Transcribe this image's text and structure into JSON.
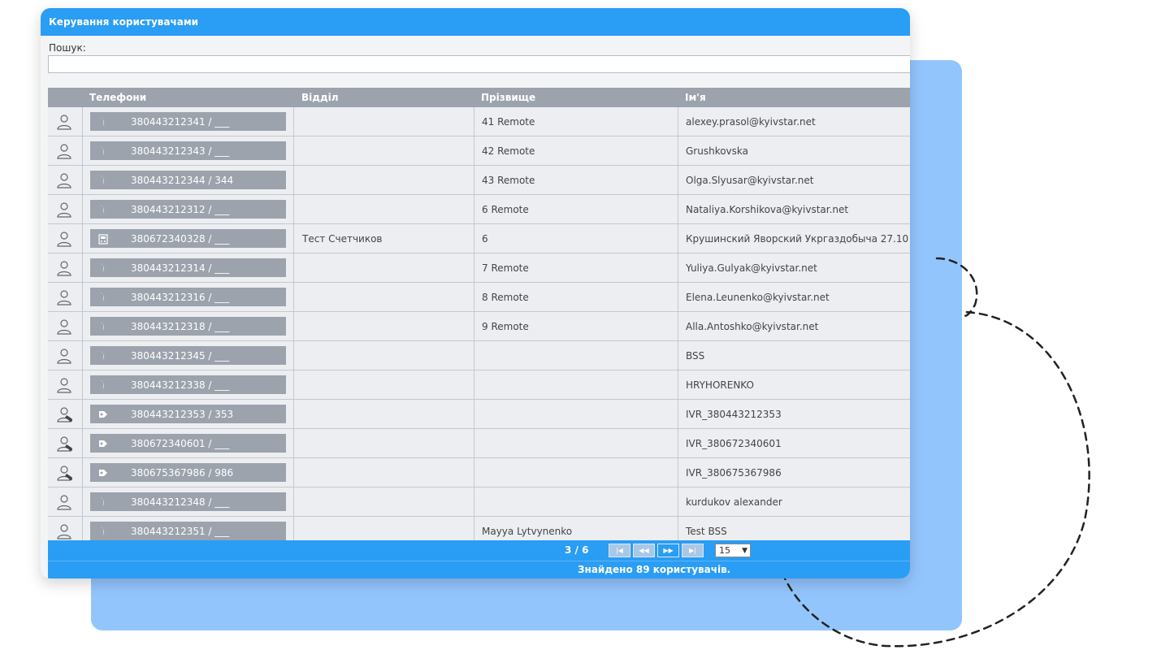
{
  "panel": {
    "title": "Керування користувачами"
  },
  "search": {
    "label": "Пошук:",
    "value": "",
    "placeholder": ""
  },
  "table": {
    "headers": {
      "phones": "Телефони",
      "department": "Відділ",
      "surname": "Прізвище",
      "name": "Ім'я"
    },
    "rows": [
      {
        "user_icon": "user-icon",
        "phone_icon": "handset-icon",
        "phone": "380443212341 / ___",
        "department": "",
        "surname": "41 Remote",
        "name": "alexey.prasol@kyivstar.net"
      },
      {
        "user_icon": "user-icon",
        "phone_icon": "handset-icon",
        "phone": "380443212343 / ___",
        "department": "",
        "surname": "42 Remote",
        "name": "Grushkovska"
      },
      {
        "user_icon": "user-icon",
        "phone_icon": "handset-icon",
        "phone": "380443212344 / 344",
        "department": "",
        "surname": "43 Remote",
        "name": "Olga.Slyusar@kyivstar.net"
      },
      {
        "user_icon": "user-icon",
        "phone_icon": "handset-icon",
        "phone": "380443212312 / ___",
        "department": "",
        "surname": "6 Remote",
        "name": "Nataliya.Korshikova@kyivstar.net"
      },
      {
        "user_icon": "user-icon",
        "phone_icon": "desk-phone-icon",
        "phone": "380672340328 / ___",
        "department": "Тест Счетчиков",
        "surname": "6",
        "name": "Крушинский Яворский Укргаздобыча 27.10"
      },
      {
        "user_icon": "user-icon",
        "phone_icon": "handset-icon",
        "phone": "380443212314 / ___",
        "department": "",
        "surname": "7 Remote",
        "name": "Yuliya.Gulyak@kyivstar.net"
      },
      {
        "user_icon": "user-icon",
        "phone_icon": "handset-icon",
        "phone": "380443212316 / ___",
        "department": "",
        "surname": "8 Remote",
        "name": "Elena.Leunenko@kyivstar.net"
      },
      {
        "user_icon": "user-icon",
        "phone_icon": "handset-icon",
        "phone": "380443212318 / ___",
        "department": "",
        "surname": "9 Remote",
        "name": "Alla.Antoshko@kyivstar.net"
      },
      {
        "user_icon": "user-icon",
        "phone_icon": "handset-icon",
        "phone": "380443212345 / ___",
        "department": "",
        "surname": "",
        "name": "BSS"
      },
      {
        "user_icon": "user-icon",
        "phone_icon": "handset-icon",
        "phone": "380443212338 / ___",
        "department": "",
        "surname": "",
        "name": "HRYHORENKO"
      },
      {
        "user_icon": "ivr-user-icon",
        "phone_icon": "ivr-phone-icon",
        "phone": "380443212353 / 353",
        "department": "",
        "surname": "",
        "name": "IVR_380443212353"
      },
      {
        "user_icon": "ivr-user-icon",
        "phone_icon": "ivr-phone-icon",
        "phone": "380672340601 / ___",
        "department": "",
        "surname": "",
        "name": "IVR_380672340601"
      },
      {
        "user_icon": "ivr-user-icon",
        "phone_icon": "ivr-phone-icon",
        "phone": "380675367986 / 986",
        "department": "",
        "surname": "",
        "name": "IVR_380675367986"
      },
      {
        "user_icon": "user-icon",
        "phone_icon": "handset-icon",
        "phone": "380443212348 / ___",
        "department": "",
        "surname": "",
        "name": "kurdukov alexander"
      },
      {
        "user_icon": "user-icon",
        "phone_icon": "handset-icon",
        "phone": "380443212351 / ___",
        "department": "",
        "surname": "Mayya Lytvynenko",
        "name": "Test BSS"
      }
    ]
  },
  "pager": {
    "page_text": "3 / 6",
    "first": "|◀",
    "prev": "◀◀",
    "next": "▶▶",
    "last": "▶|",
    "page_size": "15"
  },
  "footer": {
    "found_text": "Знайдено 89 користувачів."
  },
  "colors": {
    "accent": "#2a9df4",
    "header_gray": "#9ca3ad",
    "backdrop": "#93c5fd"
  }
}
